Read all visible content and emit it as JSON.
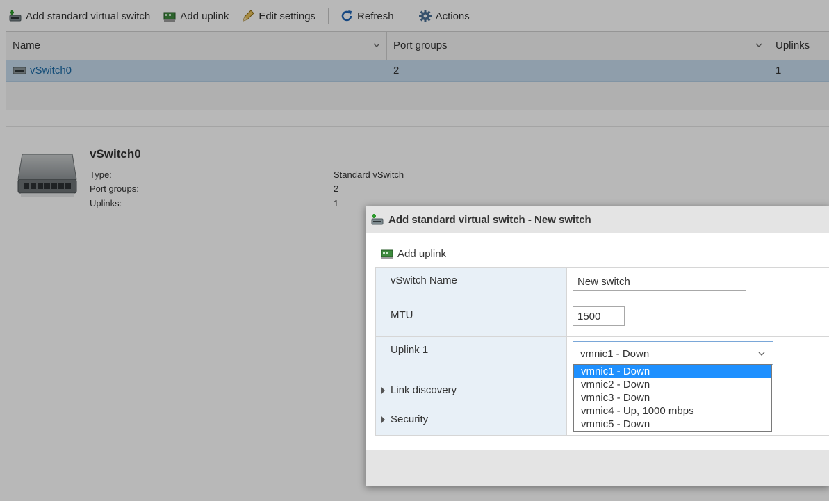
{
  "toolbar": {
    "add_switch_label": "Add standard virtual switch",
    "add_uplink_label": "Add uplink",
    "edit_settings_label": "Edit settings",
    "refresh_label": "Refresh",
    "actions_label": "Actions"
  },
  "grid": {
    "columns": [
      "Name",
      "Port groups",
      "Uplinks"
    ],
    "rows": [
      {
        "name": "vSwitch0",
        "port_groups": "2",
        "uplinks": "1"
      }
    ]
  },
  "detail": {
    "title": "vSwitch0",
    "fields": [
      {
        "label": "Type:",
        "value": "Standard vSwitch"
      },
      {
        "label": "Port groups:",
        "value": "2"
      },
      {
        "label": "Uplinks:",
        "value": "1"
      }
    ]
  },
  "modal": {
    "title": "Add standard virtual switch - New switch",
    "add_uplink_label": "Add uplink",
    "form": {
      "vswitch_name_label": "vSwitch Name",
      "vswitch_name_value": "New switch",
      "mtu_label": "MTU",
      "mtu_value": "1500",
      "uplink1_label": "Uplink 1",
      "uplink1_selected": "vmnic1 - Down",
      "link_discovery_label": "Link discovery",
      "security_label": "Security"
    },
    "uplink_options": [
      "vmnic1 - Down",
      "vmnic2 - Down",
      "vmnic3 - Down",
      "vmnic4 - Up, 1000 mbps",
      "vmnic5 - Down"
    ]
  },
  "colors": {
    "selection_row": "#c7dcee",
    "link": "#1b6aa6",
    "dropdown_highlight": "#1e90ff",
    "form_label_bg": "#e8f0f7"
  }
}
